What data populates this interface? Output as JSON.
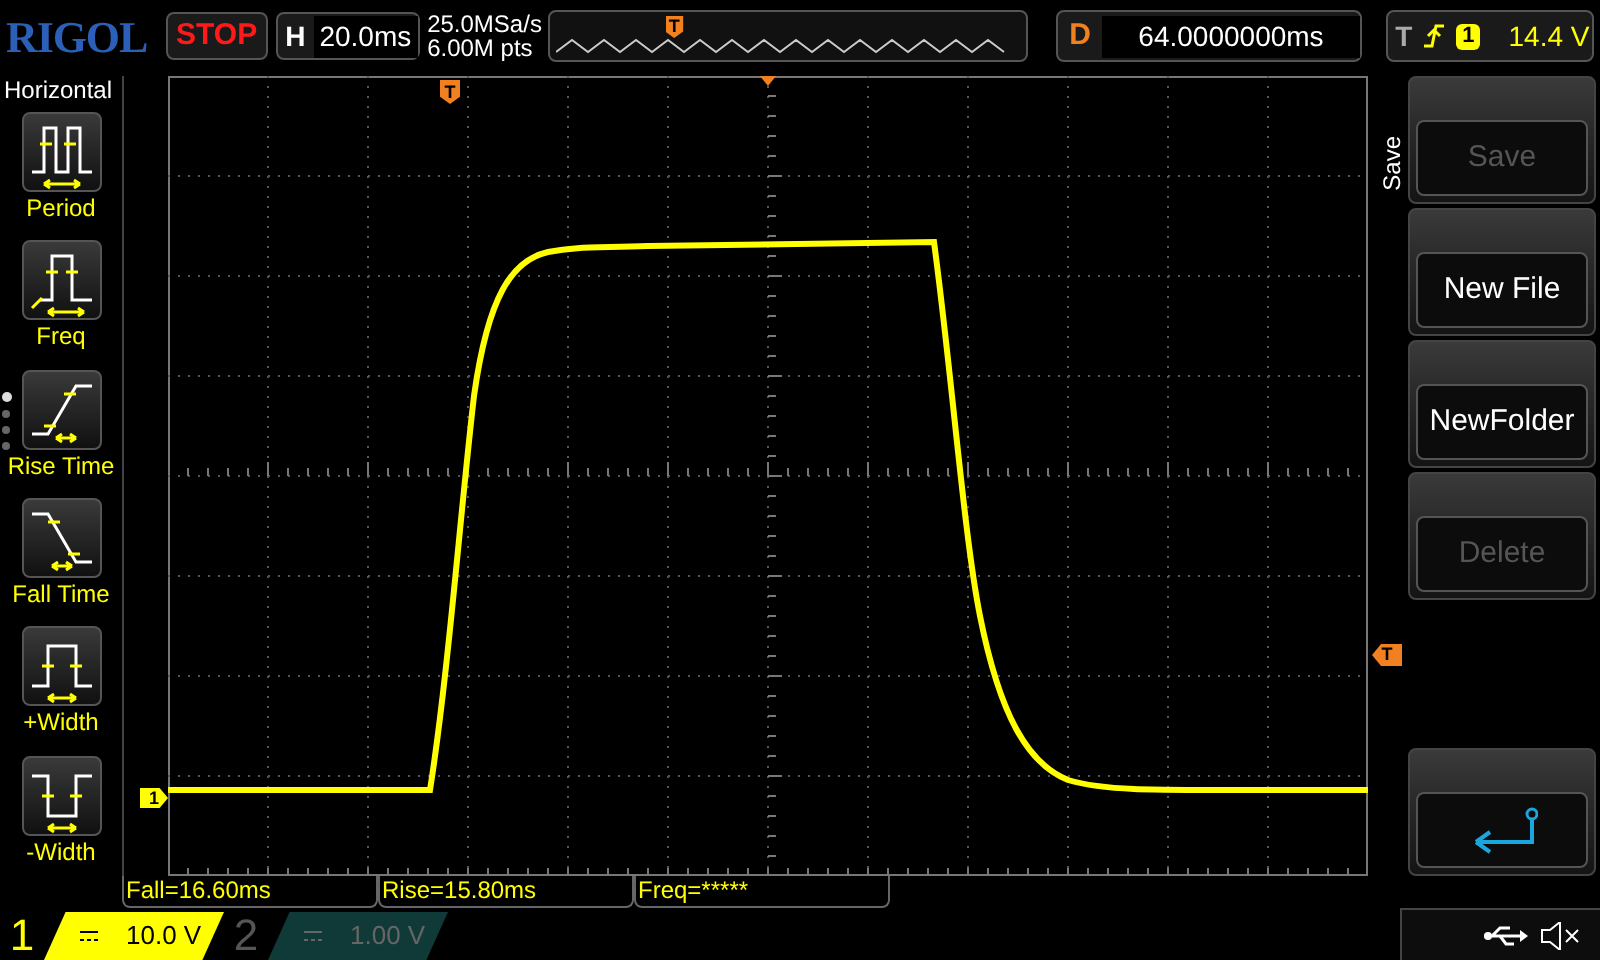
{
  "logo": "RIGOL",
  "run_status": "STOP",
  "timebase": {
    "label": "H",
    "value": "20.0ms"
  },
  "acquisition": {
    "sample_rate": "25.0MSa/s",
    "memory_depth": "6.00M pts"
  },
  "memory_bar": {
    "trigger_marker": "T"
  },
  "delay": {
    "label": "D",
    "value": "64.0000000ms"
  },
  "trigger": {
    "label": "T",
    "source": "1",
    "level_reading": "14.4 V"
  },
  "left_menu": {
    "title": "Horizontal",
    "page_dots": [
      {
        "selected": true
      },
      {
        "selected": false
      },
      {
        "selected": false
      },
      {
        "selected": false
      }
    ],
    "items": [
      {
        "label": "Period",
        "kind": "period"
      },
      {
        "label": "Freq",
        "kind": "freq"
      },
      {
        "label": "Rise Time",
        "kind": "rise"
      },
      {
        "label": "Fall Time",
        "kind": "fall"
      },
      {
        "label": "+Width",
        "kind": "pwidth"
      },
      {
        "label": "-Width",
        "kind": "nwidth"
      }
    ]
  },
  "display": {
    "trigger_position_marker": "T",
    "trigger_level_marker": "T",
    "channel_marker": "1"
  },
  "right_menu": {
    "title": "Save",
    "items": [
      {
        "kind": "button",
        "label": "Save",
        "disabled": true
      },
      {
        "kind": "button",
        "label": "New File",
        "disabled": false
      },
      {
        "kind": "button",
        "label": "NewFolder",
        "disabled": false
      },
      {
        "kind": "button",
        "label": "Delete",
        "disabled": true
      },
      {
        "kind": "back"
      }
    ]
  },
  "measurements": [
    "Fall=16.60ms",
    "Rise=15.80ms",
    "Freq=*****"
  ],
  "channels": [
    {
      "number": "1",
      "scale": "10.0 V",
      "on": true
    },
    {
      "number": "2",
      "scale": "1.00 V",
      "on": false
    }
  ]
}
